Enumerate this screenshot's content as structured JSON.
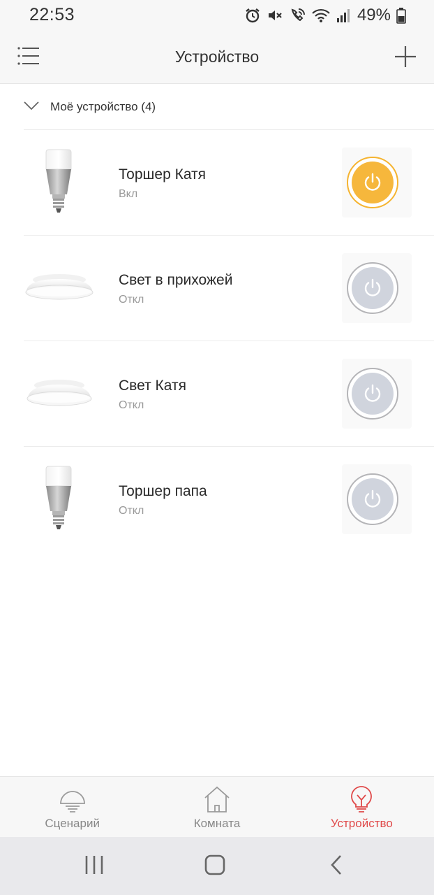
{
  "status_bar": {
    "time": "22:53",
    "battery": "49%",
    "icons": [
      "alarm-icon",
      "mute-icon",
      "wifi-call-icon",
      "wifi-icon",
      "signal-icon",
      "battery-icon"
    ]
  },
  "header": {
    "title": "Устройство",
    "menu_icon": "list-menu-icon",
    "add_icon": "plus-icon"
  },
  "group": {
    "title": "Моё устройство (4)",
    "expanded": true
  },
  "devices": [
    {
      "name": "Торшер Катя",
      "status": "Вкл",
      "type": "bulb",
      "on": true
    },
    {
      "name": "Свет в прихожей",
      "status": "Откл",
      "type": "ceiling-light",
      "on": false
    },
    {
      "name": "Свет Катя",
      "status": "Откл",
      "type": "ceiling-light",
      "on": false
    },
    {
      "name": "Торшер папа",
      "status": "Откл",
      "type": "bulb",
      "on": false
    }
  ],
  "bottom_nav": {
    "items": [
      {
        "label": "Сценарий",
        "icon": "scene-lamp-icon",
        "active": false
      },
      {
        "label": "Комната",
        "icon": "home-icon",
        "active": false
      },
      {
        "label": "Устройство",
        "icon": "bulb-icon",
        "active": true
      }
    ]
  },
  "colors": {
    "accent_on": "#f6b73c",
    "off_button": "#d0d4dd",
    "active_nav": "#e04a4a"
  }
}
